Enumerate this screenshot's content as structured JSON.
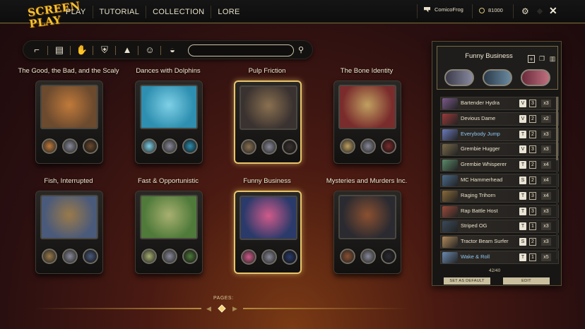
{
  "topbar": {
    "logo_text": "SCREEN PLAY",
    "nav": [
      "PLAY",
      "TUTORIAL",
      "COLLECTION",
      "LORE"
    ],
    "username": "ComicoFrog",
    "coins": "81000"
  },
  "filters": {
    "icons": [
      "gun-icon",
      "ticket-icon",
      "hand-icon",
      "badge-icon",
      "pyramid-icon",
      "mask-icon",
      "bowl-icon"
    ],
    "search_placeholder": ""
  },
  "decks": [
    {
      "title": "The Good, the Bad, and the Scaly",
      "art": "#6b4a2e",
      "art2": "#c07a3a",
      "selected": false
    },
    {
      "title": "Dances with Dolphins",
      "art": "#2e8fb0",
      "art2": "#7fd0e6",
      "selected": false
    },
    {
      "title": "Pulp Friction",
      "art": "#3a3230",
      "art2": "#8a7050",
      "selected": true
    },
    {
      "title": "The Bone Identity",
      "art": "#7a2c2c",
      "art2": "#c0a060",
      "selected": false
    },
    {
      "title": "Fish, Interrupted",
      "art": "#4a5a7a",
      "art2": "#9a7a4a",
      "selected": false
    },
    {
      "title": "Fast & Opportunistic",
      "art": "#4f7a3a",
      "art2": "#a8b070",
      "selected": false
    },
    {
      "title": "Funny Business",
      "art": "#2a3a6a",
      "art2": "#d05a8a",
      "selected": true
    },
    {
      "title": "Mysteries and Murders Inc.",
      "art": "#2a2a30",
      "art2": "#8a5030",
      "selected": false
    }
  ],
  "pages": {
    "label": "PAGES:"
  },
  "panel": {
    "title": "Funny Business",
    "count": "42/40",
    "set_default_label": "SET AS DEFAULT",
    "edit_label": "EDIT",
    "cards": [
      {
        "name": "Bartender Hydra",
        "type": "V",
        "cost": "3",
        "count": "x3",
        "blue": false,
        "color": "#7a5a8a"
      },
      {
        "name": "Devious Dame",
        "type": "V",
        "cost": "2",
        "count": "x2",
        "blue": false,
        "color": "#9a3a3a"
      },
      {
        "name": "Everybody Jump",
        "type": "T",
        "cost": "2",
        "count": "x3",
        "blue": true,
        "color": "#6a7aba"
      },
      {
        "name": "Grembie Hugger",
        "type": "V",
        "cost": "3",
        "count": "x3",
        "blue": false,
        "color": "#7a6a4a"
      },
      {
        "name": "Grembie Whisperer",
        "type": "T",
        "cost": "2",
        "count": "x4",
        "blue": false,
        "color": "#5a8a6a"
      },
      {
        "name": "MC Hammerhead",
        "type": "S",
        "cost": "2",
        "count": "x4",
        "blue": false,
        "color": "#4a6a8a"
      },
      {
        "name": "Raging Trihorn",
        "type": "T",
        "cost": "3",
        "count": "x4",
        "blue": false,
        "color": "#8a6a3a"
      },
      {
        "name": "Rap Battle Host",
        "type": "T",
        "cost": "3",
        "count": "x3",
        "blue": false,
        "color": "#9a4a3a"
      },
      {
        "name": "Striped OG",
        "type": "T",
        "cost": "1",
        "count": "x3",
        "blue": false,
        "color": "#3a4a5a"
      },
      {
        "name": "Tractor Beam Surfer",
        "type": "S",
        "cost": "2",
        "count": "x3",
        "blue": false,
        "color": "#b08a5a"
      },
      {
        "name": "Wake & Roll",
        "type": "T",
        "cost": "1",
        "count": "x5",
        "blue": true,
        "color": "#6a8ab0"
      }
    ]
  },
  "colors": {
    "gold": "#e8c56a",
    "blue_text": "#8fc6f2"
  }
}
